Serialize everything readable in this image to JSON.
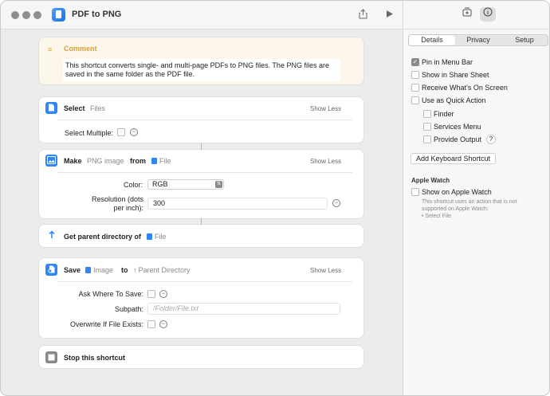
{
  "window": {
    "title": "PDF to PNG"
  },
  "sidebar": {
    "tabs": [
      "Details",
      "Privacy",
      "Setup"
    ],
    "options": [
      {
        "label": "Pin in Menu Bar",
        "checked": true
      },
      {
        "label": "Show in Share Sheet",
        "checked": false
      },
      {
        "label": "Receive What’s On Screen",
        "checked": false
      },
      {
        "label": "Use as Quick Action",
        "checked": false
      }
    ],
    "quick_action_options": [
      {
        "label": "Finder",
        "checked": false
      },
      {
        "label": "Services Menu",
        "checked": false
      },
      {
        "label": "Provide Output",
        "checked": false
      }
    ],
    "help_label": "?",
    "keyboard_button": "Add Keyboard Shortcut",
    "apple_watch_section": "Apple Watch",
    "show_on_watch": "Show on Apple Watch",
    "watch_note_line1": "This shortcut uses an action that is not",
    "watch_note_line2": "supported on Apple Watch:",
    "watch_note_line3": "• Select File"
  },
  "comment": {
    "title": "Comment",
    "line1": "This shortcut converts single- and multi-page PDFs to PNG files. The PNG files are",
    "line2": "saved in the same folder as the PDF file."
  },
  "select_action": {
    "verb": "Select",
    "token": "Files",
    "show_less": "Show Less",
    "multiple_label": "Select Multiple:"
  },
  "make_action": {
    "verb": "Make",
    "token": "PNG image",
    "from": "from",
    "source": "File",
    "show_less": "Show Less",
    "color_label": "Color:",
    "color_value": "RGB",
    "resolution_label_1": "Resolution (dots",
    "resolution_label_2": "per inch):",
    "resolution_value": "300"
  },
  "parent_action": {
    "verb": "Get parent directory of",
    "token": "File"
  },
  "save_action": {
    "verb": "Save",
    "token": "Image",
    "to": "to",
    "dest": "Parent Directory",
    "show_less": "Show Less",
    "ask_label": "Ask Where To Save:",
    "subpath_label": "Subpath:",
    "subpath_placeholder": "/Folder/File.txt",
    "overwrite_label": "Overwrite If File Exists:"
  },
  "stop_action": {
    "verb": "Stop this shortcut"
  }
}
